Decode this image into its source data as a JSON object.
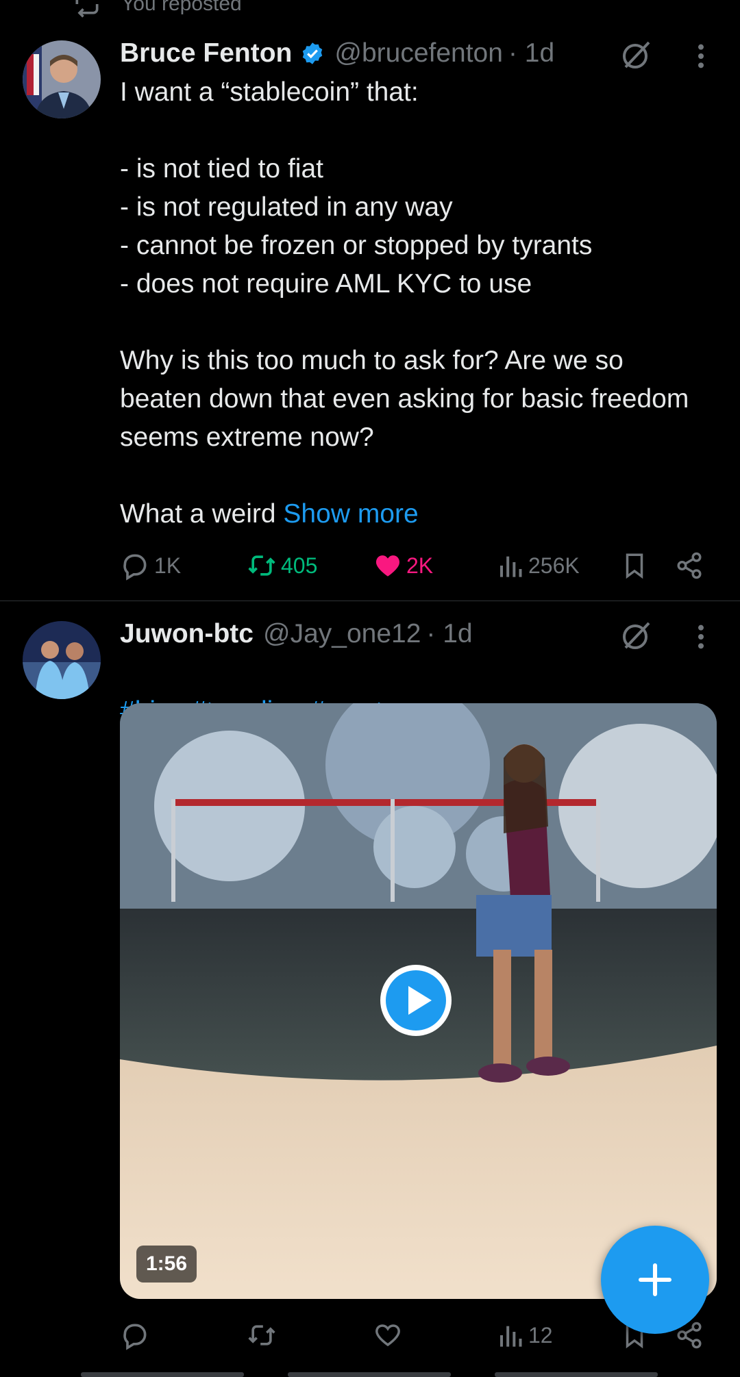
{
  "repost_banner": {
    "text": "You reposted"
  },
  "tweets": [
    {
      "name": "Bruce Fenton",
      "handle": "@brucefenton",
      "time": "· 1d",
      "text_main": "I want a “stablecoin” that:\n\n- is not tied to fiat\n- is not regulated in any way\n- cannot be frozen or stopped by tyrants\n- does not require AML KYC to use\n\nWhy is this too much to ask for?  Are we so beaten down that even asking for basic freedom seems extreme now?\n\nWhat a weird ",
      "show_more": "Show more",
      "replies": "1K",
      "reposts": "405",
      "likes": "2K",
      "views": "256K"
    },
    {
      "name": "Juwon-btc",
      "handle": "@Jay_one12",
      "time": "· 1d",
      "hashtags": "#hive #trending #crypto",
      "video_duration": "1:56",
      "views": "12"
    }
  ],
  "colors": {
    "accent": "#1d9bf0",
    "repost_active": "#00ba7c",
    "like_active": "#f91880",
    "muted": "#71767b"
  },
  "icons": [
    "repost-icon",
    "verified-icon",
    "grok-icon",
    "more-icon",
    "reply-icon",
    "like-icon",
    "views-icon",
    "bookmark-icon",
    "share-icon",
    "play-icon",
    "plus-icon"
  ]
}
